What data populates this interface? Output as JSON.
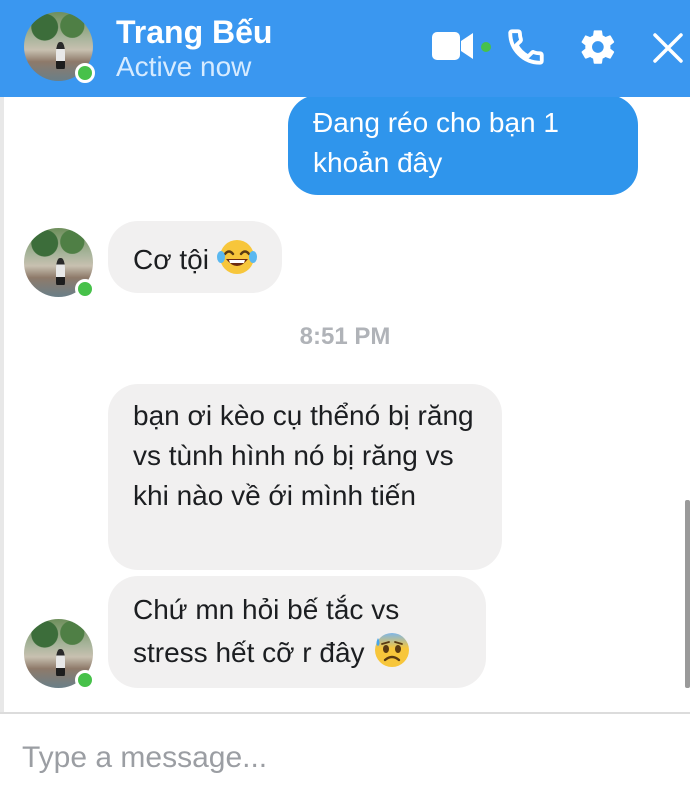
{
  "header": {
    "contact_name": "Trang Bếu",
    "status": "Active now",
    "icons": [
      "video-camera-icon",
      "phone-icon",
      "gear-icon",
      "close-icon"
    ],
    "online_color": "#47c14a",
    "bar_color": "#3a97f0"
  },
  "messages": {
    "m1": {
      "sender": "me",
      "text": "Đang réo cho bạn 1 khoản đây"
    },
    "m2": {
      "sender": "contact",
      "text": "Cơ tội",
      "emoji": "laughing-tears-emoji"
    },
    "timestamp": "8:51 PM",
    "m3": {
      "sender": "contact",
      "text": "bạn ơi kèo cụ thểnó bị răng vs tùnh hình nó bị răng vs khi nào về ới mình tiến"
    },
    "m4": {
      "sender": "contact",
      "text": "Chứ mn hỏi bế tắc vs stress hết cỡ r đây",
      "emoji": "anxious-sweat-emoji"
    }
  },
  "composer": {
    "placeholder": "Type a message..."
  },
  "colors": {
    "my_bubble": "#2f95ec",
    "their_bubble": "#f1f0f0"
  }
}
